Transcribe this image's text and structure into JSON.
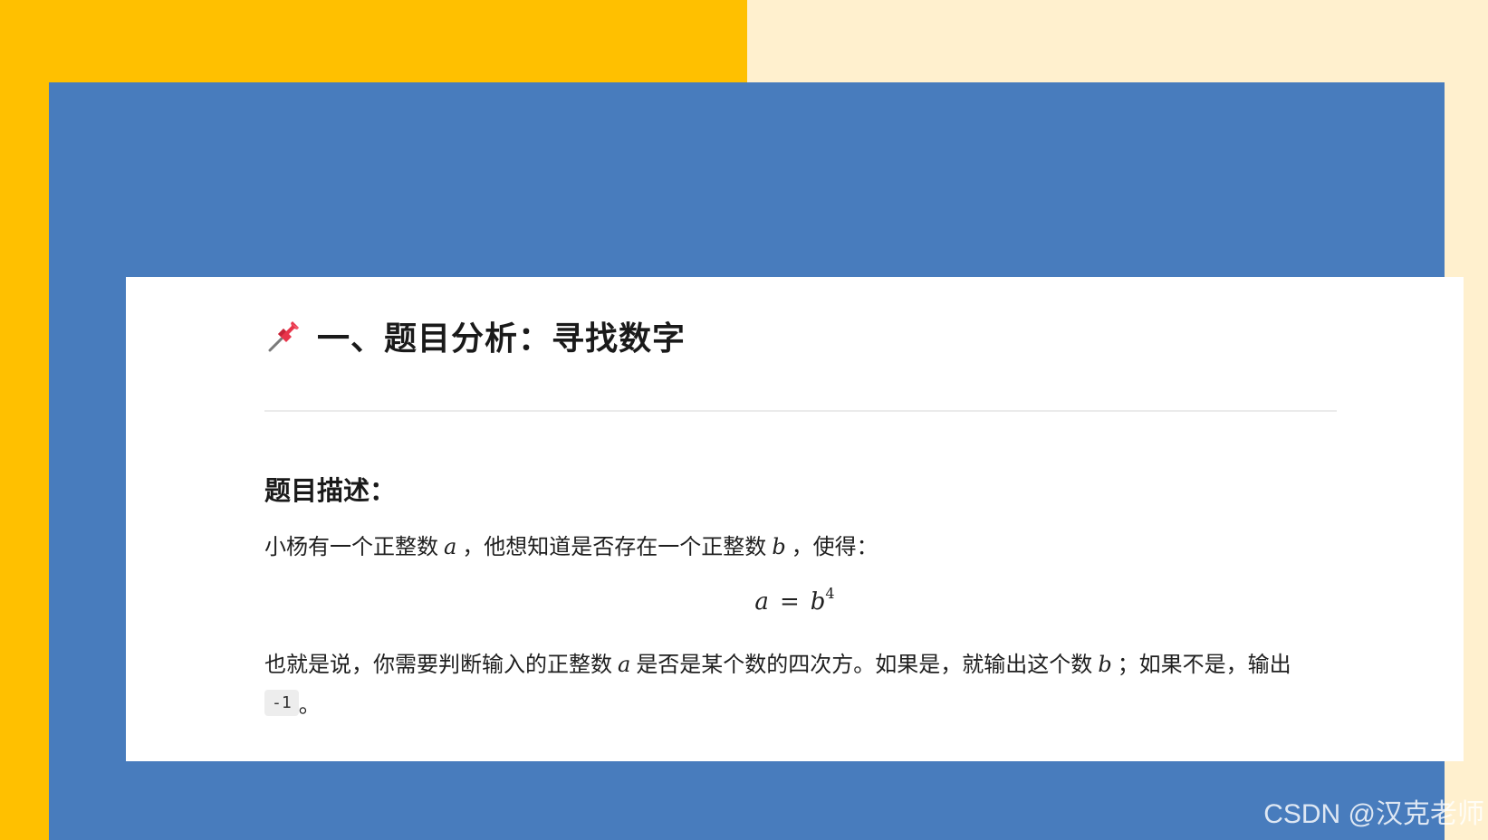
{
  "colors": {
    "left_background": "#FFC000",
    "right_background": "#FFF0CE",
    "panel": "#487CBD",
    "card": "#FFFFFF"
  },
  "heading": {
    "icon": "pushpin-icon",
    "text": "一、题目分析：寻找数字"
  },
  "section": {
    "title": "题目描述："
  },
  "paragraph1": {
    "part1": "小杨有一个正整数",
    "var_a": "a",
    "part2": "，他想知道是否存在一个正整数",
    "var_b": "b",
    "part3": "，使得："
  },
  "formula": {
    "lhs": "a",
    "op": "=",
    "base": "b",
    "exponent": "4"
  },
  "paragraph2": {
    "part1": "也就是说，你需要判断输入的正整数",
    "var_a": "a",
    "part2": "是否是某个数的四次方。如果是，就输出这个数",
    "var_b": "b",
    "part3": "；如果不是，输出"
  },
  "last_line": {
    "code": "-1",
    "tail": "。"
  },
  "watermark": "CSDN @汉克老师"
}
